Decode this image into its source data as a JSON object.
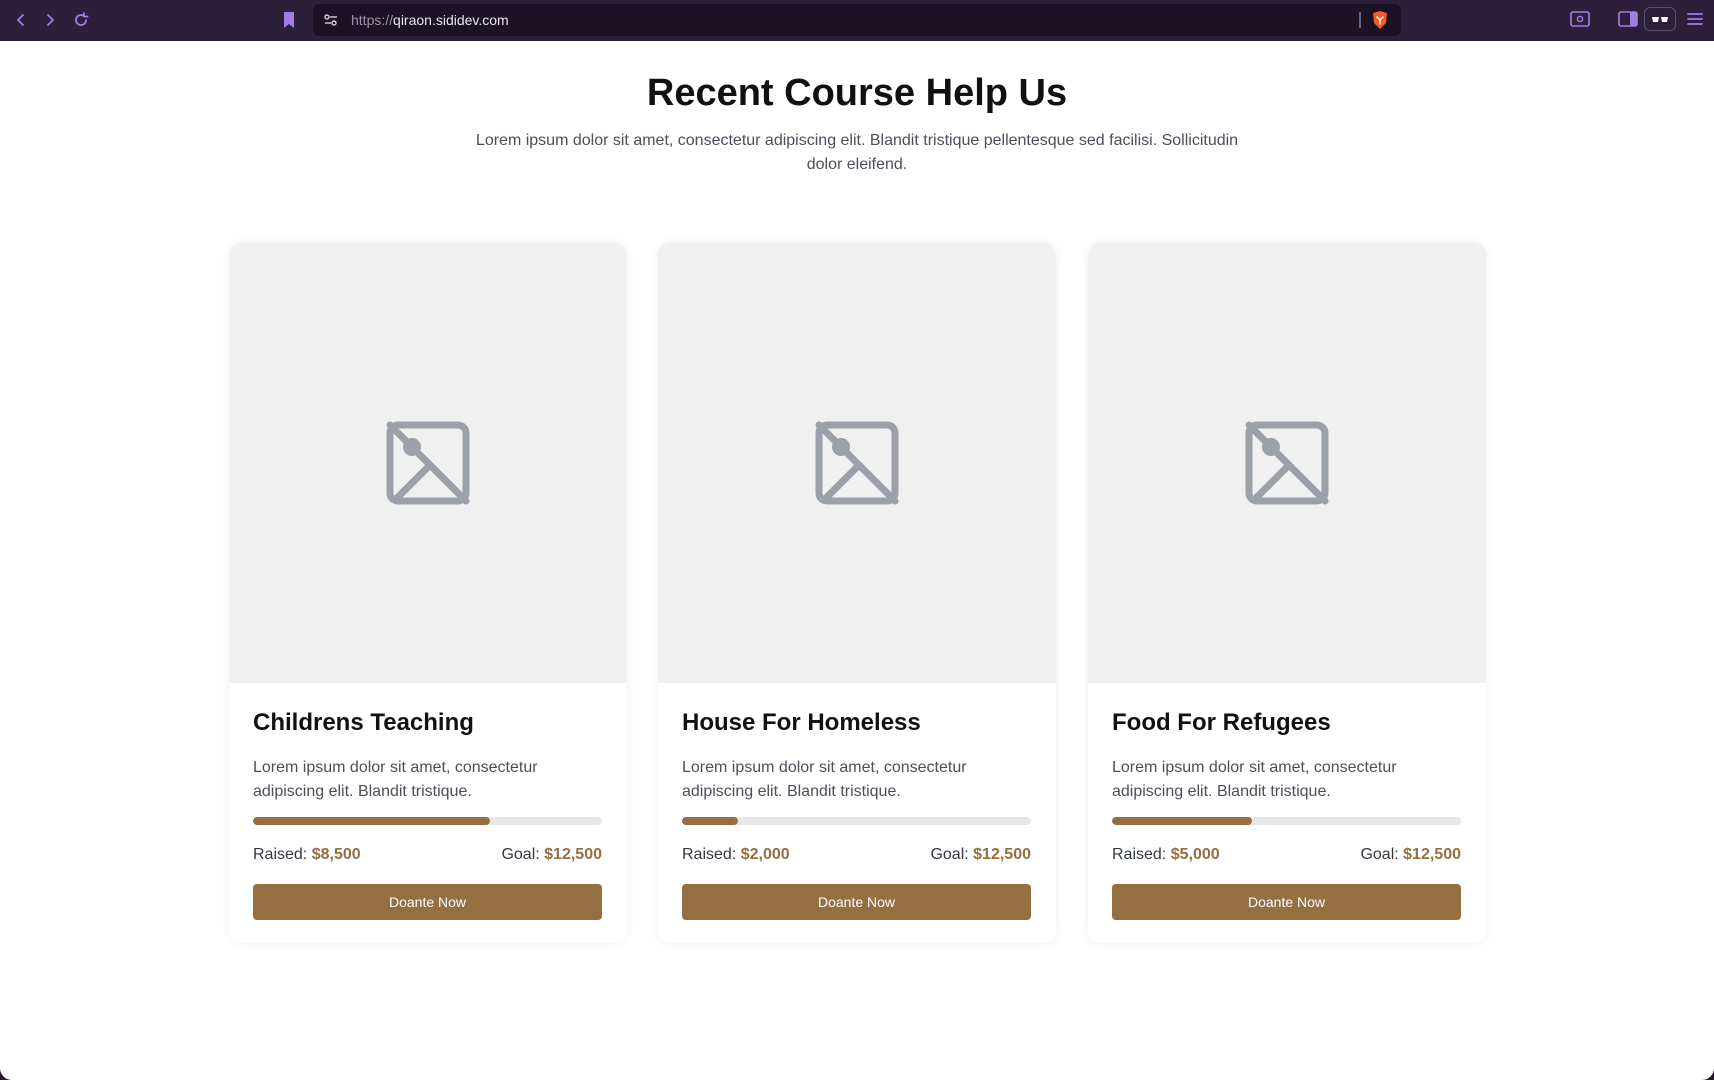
{
  "browser": {
    "url_protocol": "https://",
    "url_host": "qiraon.sididev.com",
    "accent": "#a37ce6"
  },
  "page": {
    "heading": "Recent Course Help Us",
    "subtitle": "Lorem ipsum dolor sit amet, consectetur adipiscing elit. Blandit tristique pellentesque sed facilisi. Sollicitudin dolor eleifend."
  },
  "cards": [
    {
      "title": "Childrens Teaching",
      "description": "Lorem ipsum dolor sit amet, consectetur adipiscing elit. Blandit tristique.",
      "raised_label": "Raised:",
      "raised": "$8,500",
      "goal_label": "Goal:",
      "goal": "$12,500",
      "progress": 0.68,
      "button": "Doante Now",
      "image_icon": "image-placeholder-icon"
    },
    {
      "title": "House For Homeless",
      "description": "Lorem ipsum dolor sit amet, consectetur adipiscing elit. Blandit tristique.",
      "raised_label": "Raised:",
      "raised": "$2,000",
      "goal_label": "Goal:",
      "goal": "$12,500",
      "progress": 0.16,
      "button": "Doante Now",
      "image_icon": "image-placeholder-icon"
    },
    {
      "title": "Food For Refugees",
      "description": "Lorem ipsum dolor sit amet, consectetur adipiscing elit. Blandit tristique.",
      "raised_label": "Raised:",
      "raised": "$5,000",
      "goal_label": "Goal:",
      "goal": "$12,500",
      "progress": 0.4,
      "button": "Doante Now",
      "image_icon": "image-placeholder-icon"
    }
  ],
  "colors": {
    "brand": "#946f42",
    "track": "#e6e6e8",
    "placeholder_bg": "#f0f0f0",
    "placeholder_icon": "#9ca0a8"
  }
}
